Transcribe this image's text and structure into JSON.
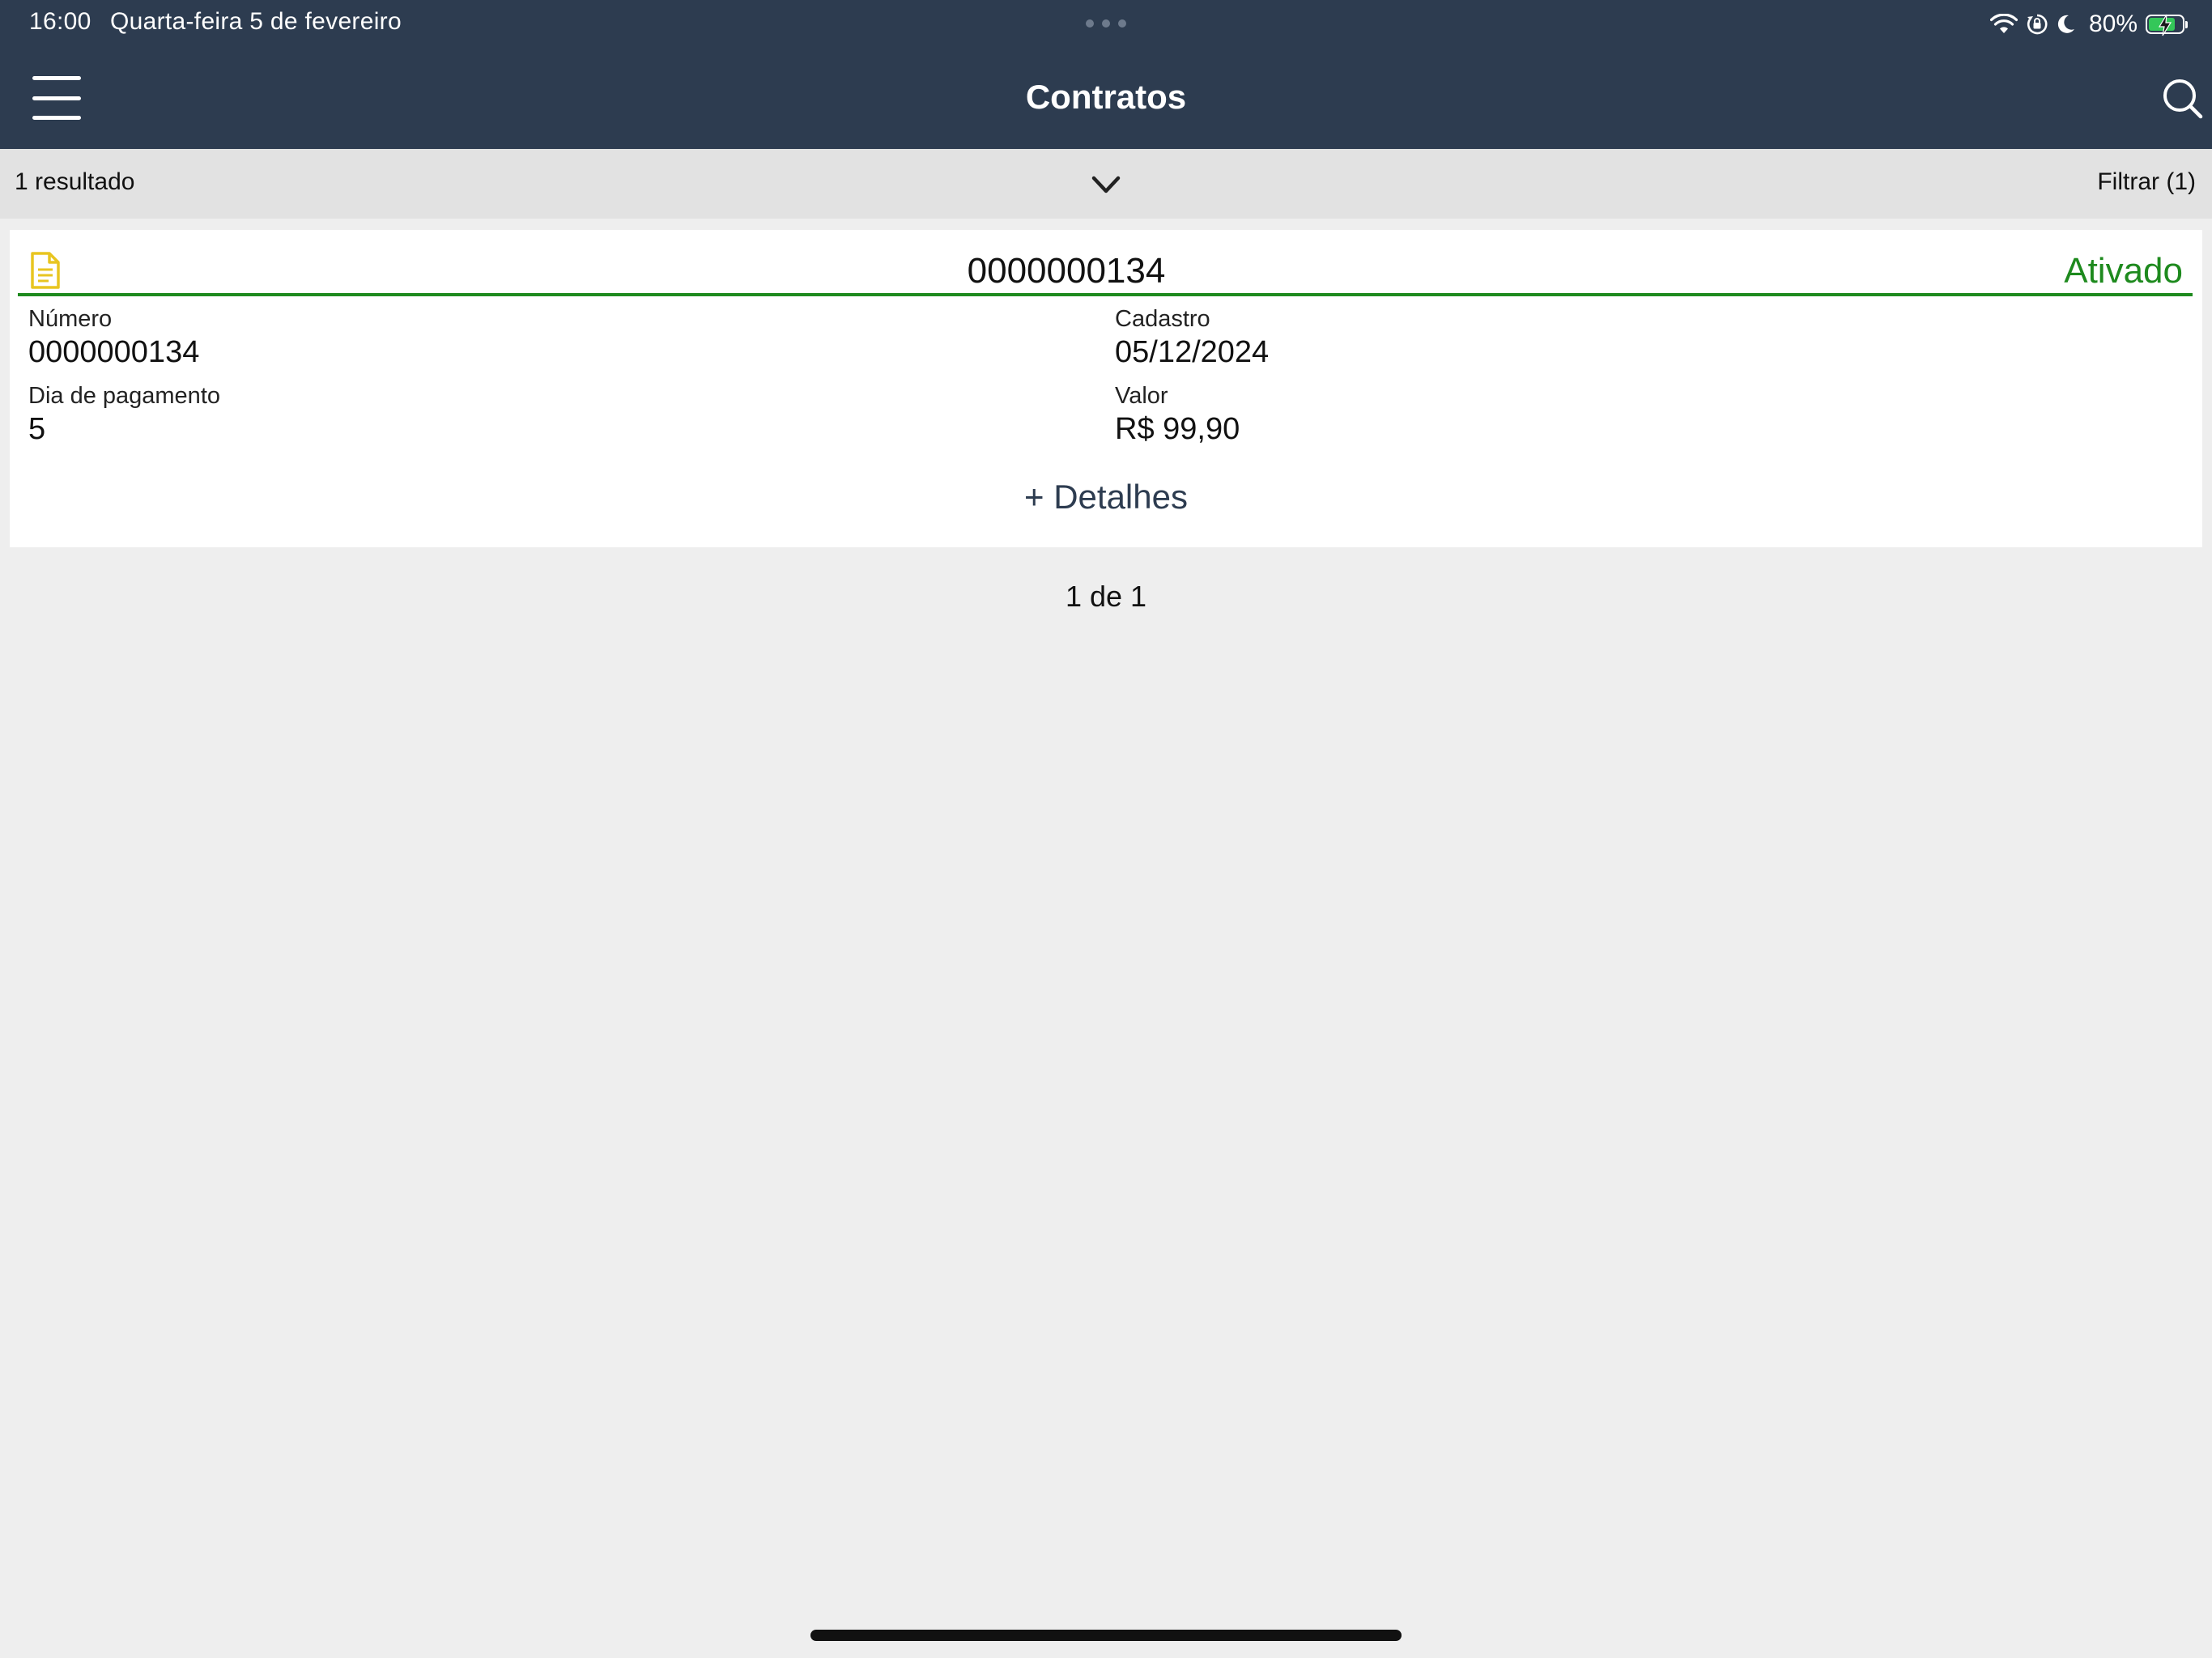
{
  "status_bar": {
    "time": "16:00",
    "date": "Quarta-feira 5 de fevereiro",
    "battery_percent": "80%",
    "icons": [
      "wifi-icon",
      "orientation-lock-icon",
      "moon-icon",
      "battery-charging-icon"
    ]
  },
  "nav": {
    "title": "Contratos",
    "menu_icon": "hamburger-menu-icon",
    "search_icon": "search-icon"
  },
  "filter_bar": {
    "result_count": "1 resultado",
    "expand_icon": "chevron-down-icon",
    "filter_label": "Filtrar (1)"
  },
  "contracts": [
    {
      "title": "0000000134",
      "status": "Ativado",
      "status_color": "#1e8a1e",
      "icon": "document-icon",
      "icon_color": "#e8c520",
      "fields": {
        "numero_label": "Número",
        "numero_value": "0000000134",
        "cadastro_label": "Cadastro",
        "cadastro_value": "05/12/2024",
        "dia_pagamento_label": "Dia de pagamento",
        "dia_pagamento_value": "5",
        "valor_label": "Valor",
        "valor_value": "R$ 99,90"
      },
      "details_label": "+ Detalhes"
    }
  ],
  "pagination": {
    "label": "1 de 1"
  },
  "colors": {
    "header_bg": "#2d3c50",
    "filter_bar_bg": "#e2e2e2",
    "page_bg": "#eeeeee",
    "accent_green": "#1e8a1e"
  }
}
